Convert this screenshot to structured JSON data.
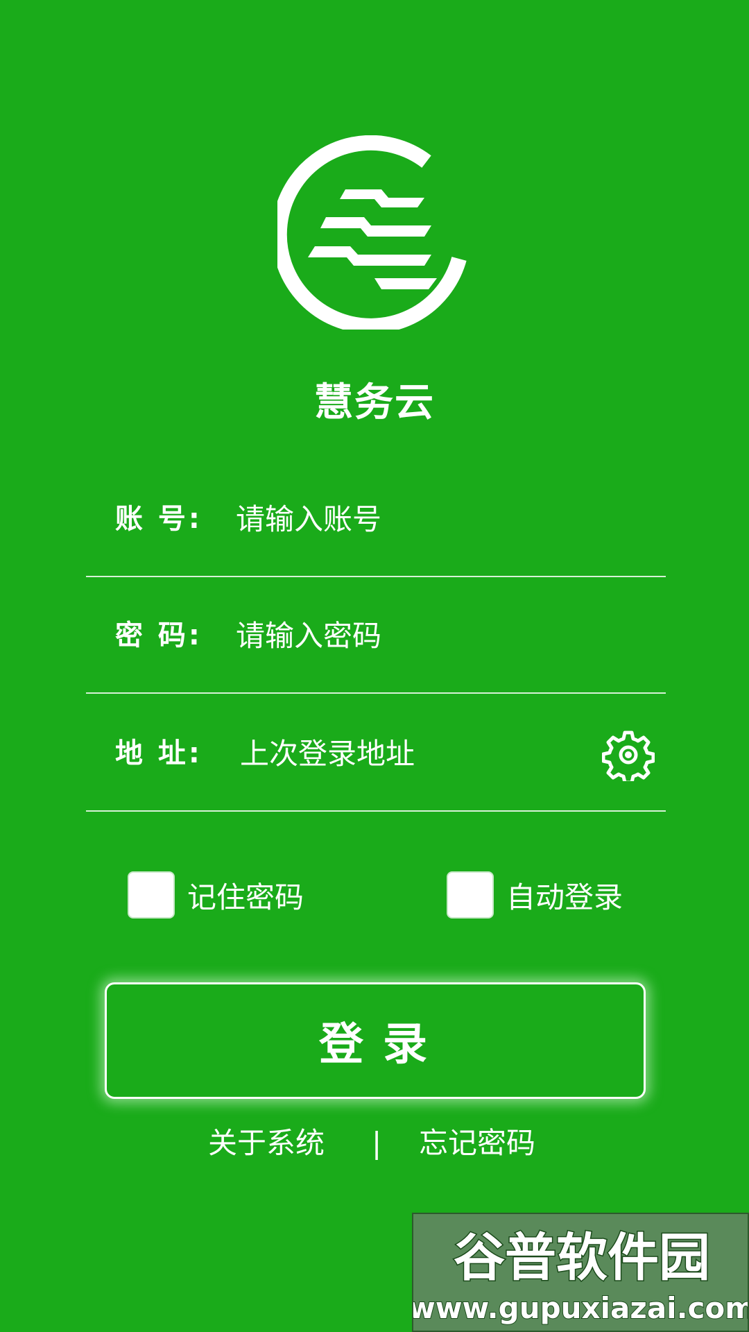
{
  "app": {
    "name": "慧务云"
  },
  "form": {
    "account": {
      "label": "账 号:",
      "placeholder": "请输入账号",
      "value": ""
    },
    "password": {
      "label": "密 码:",
      "placeholder": "请输入密码",
      "value": ""
    },
    "address": {
      "label": "地 址:",
      "placeholder": "上次登录地址",
      "value": ""
    }
  },
  "options": {
    "remember_password": {
      "label": "记住密码",
      "checked": false
    },
    "auto_login": {
      "label": "自动登录",
      "checked": false
    }
  },
  "login_button": {
    "label": "登录"
  },
  "links": {
    "about": "关于系统",
    "separator": "|",
    "forgot_password": "忘记密码"
  },
  "watermark": {
    "title": "谷普软件园",
    "url": "www.gupuxiazai.com"
  },
  "icons": {
    "logo": "brand-logo",
    "settings": "gear-icon"
  },
  "colors": {
    "background": "#1aab1a",
    "foreground": "#ffffff",
    "watermark_bg": "#5a8a5a"
  }
}
